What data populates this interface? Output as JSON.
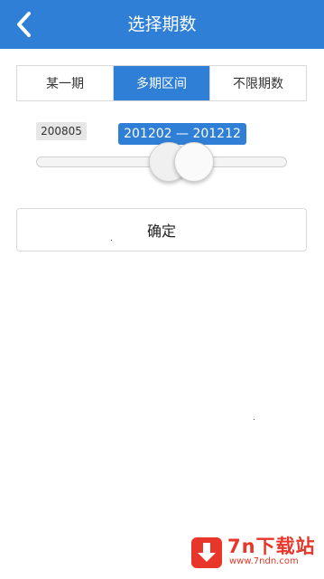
{
  "header": {
    "title": "选择期数"
  },
  "tabs": [
    {
      "label": "某一期",
      "active": false
    },
    {
      "label": "多期区间",
      "active": true
    },
    {
      "label": "不限期数",
      "active": false
    }
  ],
  "range": {
    "min_label": "200805",
    "selected_label": "201202 — 201212"
  },
  "confirm": {
    "label": "确定"
  },
  "watermark": {
    "main": "7n下载站",
    "sub": "www.7ndn.com"
  },
  "colors": {
    "accent": "#2f7fd6",
    "watermark": "#e8362a"
  }
}
